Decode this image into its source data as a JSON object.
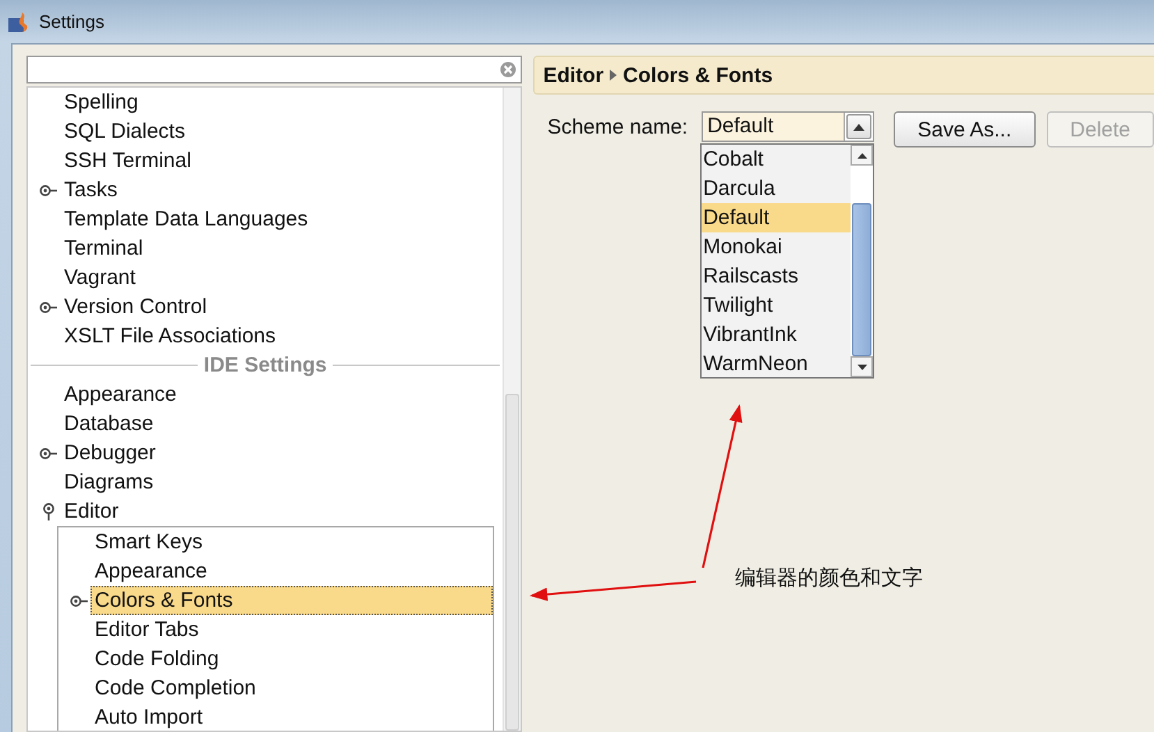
{
  "window": {
    "title": "Settings"
  },
  "tree": {
    "project_items": [
      {
        "label": "Spelling",
        "kind": "leaf",
        "selected": false
      },
      {
        "label": "SQL Dialects",
        "kind": "leaf",
        "selected": false
      },
      {
        "label": "SSH Terminal",
        "kind": "leaf",
        "selected": false
      },
      {
        "label": "Tasks",
        "kind": "node",
        "expanded": false,
        "selected": false
      },
      {
        "label": "Template Data Languages",
        "kind": "leaf",
        "selected": false
      },
      {
        "label": "Terminal",
        "kind": "leaf",
        "selected": false
      },
      {
        "label": "Vagrant",
        "kind": "leaf",
        "selected": false
      },
      {
        "label": "Version Control",
        "kind": "node",
        "expanded": false,
        "selected": false
      },
      {
        "label": "XSLT File Associations",
        "kind": "leaf",
        "selected": false
      }
    ],
    "section_label": "IDE Settings",
    "ide_items": [
      {
        "label": "Appearance",
        "kind": "leaf",
        "selected": false
      },
      {
        "label": "Database",
        "kind": "leaf",
        "selected": false
      },
      {
        "label": "Debugger",
        "kind": "node",
        "expanded": false,
        "selected": false
      },
      {
        "label": "Diagrams",
        "kind": "leaf",
        "selected": false
      },
      {
        "label": "Editor",
        "kind": "node",
        "expanded": true,
        "selected": false,
        "children": [
          {
            "label": "Smart Keys",
            "kind": "leaf",
            "selected": false
          },
          {
            "label": "Appearance",
            "kind": "leaf",
            "selected": false
          },
          {
            "label": "Colors & Fonts",
            "kind": "node",
            "expanded": false,
            "selected": true
          },
          {
            "label": "Editor Tabs",
            "kind": "leaf",
            "selected": false
          },
          {
            "label": "Code Folding",
            "kind": "leaf",
            "selected": false
          },
          {
            "label": "Code Completion",
            "kind": "leaf",
            "selected": false
          },
          {
            "label": "Auto Import",
            "kind": "leaf",
            "selected": false
          }
        ]
      }
    ]
  },
  "breadcrumb": [
    "Editor",
    "Colors & Fonts"
  ],
  "scheme": {
    "label": "Scheme name:",
    "value": "Default",
    "expanded": true,
    "options": [
      {
        "label": "Cobalt",
        "selected": false
      },
      {
        "label": "Darcula",
        "selected": false
      },
      {
        "label": "Default",
        "selected": true
      },
      {
        "label": "Monokai",
        "selected": false
      },
      {
        "label": "Railscasts",
        "selected": false
      },
      {
        "label": "Twilight",
        "selected": false
      },
      {
        "label": "VibrantInk",
        "selected": false
      },
      {
        "label": "WarmNeon",
        "selected": false
      }
    ]
  },
  "buttons": [
    {
      "label": "Save As...",
      "disabled": false
    },
    {
      "label": "Delete",
      "disabled": true
    }
  ],
  "annotation": {
    "text": "编辑器的颜色和文字"
  }
}
